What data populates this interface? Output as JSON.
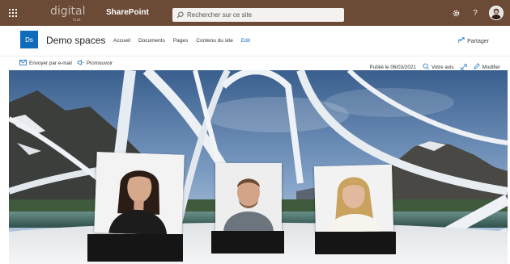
{
  "suite": {
    "logo_text": "digital",
    "logo_sub": "hub",
    "app_name": "SharePoint",
    "search_placeholder": "Rechercher sur ce site",
    "help_glyph": "?"
  },
  "site": {
    "logo_text": "Ds",
    "title": "Demo spaces",
    "nav": [
      "Accueil",
      "Documents",
      "Pages",
      "Contenu du site",
      "Edit"
    ],
    "share_label": "Partager"
  },
  "commandbar": {
    "email_label": "Envoyer par e-mail",
    "promote_label": "Promouvoir",
    "published": "Publié le 06/03/2021",
    "feedback_label": "Votre avis",
    "edit_label": "Modifier"
  },
  "colors": {
    "suitebar": "#6b4a36",
    "accent": "#0f6cbd"
  },
  "icons": [
    "app-launcher-icon",
    "search-icon",
    "settings-icon",
    "help-icon",
    "share-icon",
    "mail-icon",
    "megaphone-icon",
    "feedback-icon",
    "expand-icon",
    "pencil-icon"
  ]
}
